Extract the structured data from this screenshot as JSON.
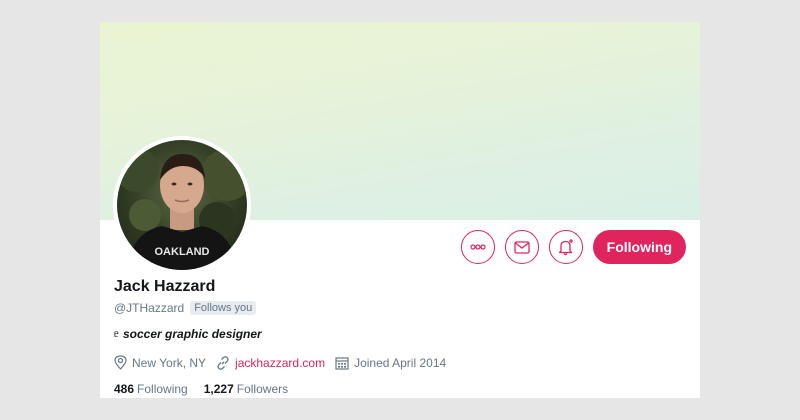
{
  "profile": {
    "name": "Jack Hazzard",
    "handle": "@JTHazzard",
    "follows_you_badge": "Follows you",
    "bio_glyph": "ᥱ",
    "bio": "soccer graphic designer",
    "location": "New York, NY",
    "website": "jackhazzard.com",
    "joined": "Joined April 2014",
    "following_count": "486",
    "following_label": "Following",
    "followers_count": "1,227",
    "followers_label": "Followers"
  },
  "actions": {
    "more_icon": "more-icon",
    "message_icon": "envelope-icon",
    "notify_icon": "bell-plus-icon",
    "follow_button_label": "Following"
  },
  "colors": {
    "accent": "#e0245e",
    "secondary_text": "#657786",
    "primary_text": "#14171a",
    "badge_bg": "#e6ecf0"
  },
  "avatar_shirt_text": "OAKLAND"
}
